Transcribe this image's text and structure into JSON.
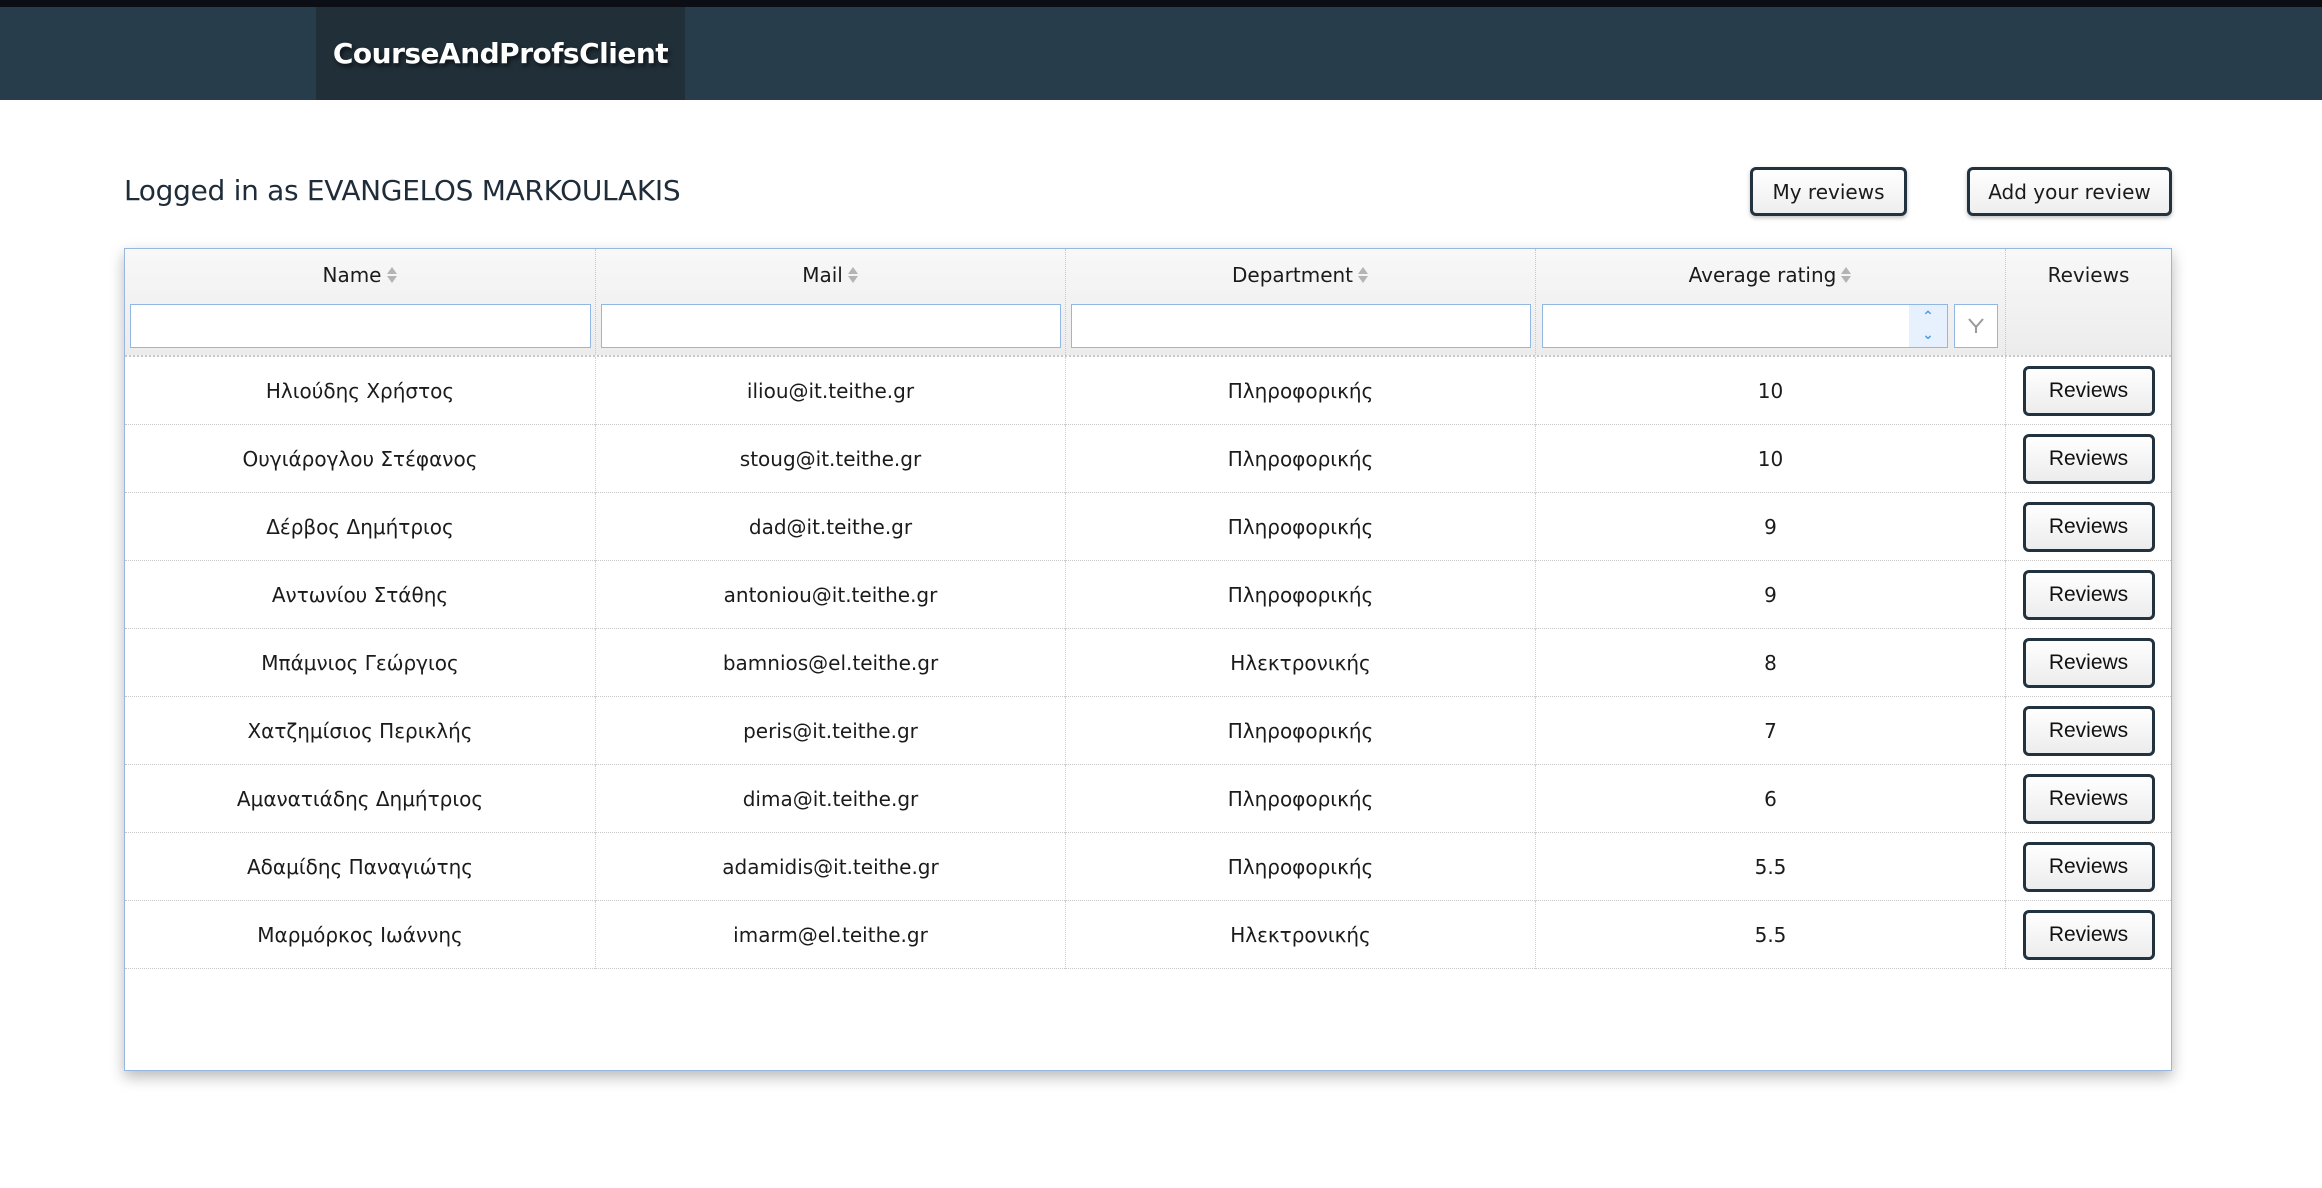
{
  "app": {
    "brand": "CourseAndProfsClient"
  },
  "header": {
    "logged_in_text": "Logged in as EVANGELOS MARKOULAKIS",
    "my_reviews_label": "My reviews",
    "add_review_label": "Add your review"
  },
  "grid": {
    "columns": [
      {
        "label": "Name",
        "sortable": true,
        "filter": "text"
      },
      {
        "label": "Mail",
        "sortable": true,
        "filter": "text"
      },
      {
        "label": "Department",
        "sortable": true,
        "filter": "text"
      },
      {
        "label": "Average rating",
        "sortable": true,
        "filter": "numeric"
      },
      {
        "label": "Reviews",
        "sortable": false,
        "filter": "none"
      }
    ],
    "filters": {
      "name": "",
      "mail": "",
      "department": "",
      "average_rating": ""
    },
    "row_button_label": "Reviews",
    "rows": [
      {
        "name": "Ηλιούδης Χρήστος",
        "mail": "iliou@it.teithe.gr",
        "department": "Πληροφορικής",
        "rating": "10"
      },
      {
        "name": "Ουγιάρογλου Στέφανος",
        "mail": "stoug@it.teithe.gr",
        "department": "Πληροφορικής",
        "rating": "10"
      },
      {
        "name": "Δέρβος Δημήτριος",
        "mail": "dad@it.teithe.gr",
        "department": "Πληροφορικής",
        "rating": "9"
      },
      {
        "name": "Αντωνίου Στάθης",
        "mail": "antoniou@it.teithe.gr",
        "department": "Πληροφορικής",
        "rating": "9"
      },
      {
        "name": "Μπάμνιος Γεώργιος",
        "mail": "bamnios@el.teithe.gr",
        "department": "Ηλεκτρονικής",
        "rating": "8"
      },
      {
        "name": "Χατζημίσιος Περικλής",
        "mail": "peris@it.teithe.gr",
        "department": "Πληροφορικής",
        "rating": "7"
      },
      {
        "name": "Αμανατιάδης Δημήτριος",
        "mail": "dima@it.teithe.gr",
        "department": "Πληροφορικής",
        "rating": "6"
      },
      {
        "name": "Αδαμίδης Παναγιώτης",
        "mail": "adamidis@it.teithe.gr",
        "department": "Πληροφορικής",
        "rating": "5.5"
      },
      {
        "name": "Μαρμόρκος Ιωάννης",
        "mail": "imarm@el.teithe.gr",
        "department": "Ηλεκτρονικής",
        "rating": "5.5"
      }
    ]
  },
  "icons": {
    "sort": "sort-icon",
    "spin_up": "^",
    "spin_down": "v",
    "filter": "filter-icon"
  },
  "colors": {
    "navbar": "#283d4b",
    "brand_bg": "#212f39",
    "button_border": "#22323e",
    "grid_border": "#98b7de",
    "input_border": "#93b7e3"
  }
}
